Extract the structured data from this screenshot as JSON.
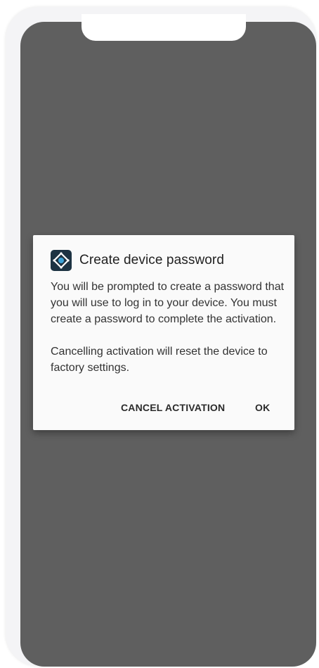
{
  "dialog": {
    "icon": "device-app-icon",
    "title": "Create device password",
    "body_paragraph_1": "You will be prompted to create a password that you will use to log in to your device. You must create a password to complete the activation.",
    "body_paragraph_2": "Cancelling activation will reset the device to factory settings.",
    "cancel_label": "CANCEL ACTIVATION",
    "ok_label": "OK"
  },
  "colors": {
    "screen_dim": "#5f5f5f",
    "dialog_bg": "#fafafa",
    "icon_bg": "#1d3343",
    "icon_accent": "#3da3d8"
  }
}
